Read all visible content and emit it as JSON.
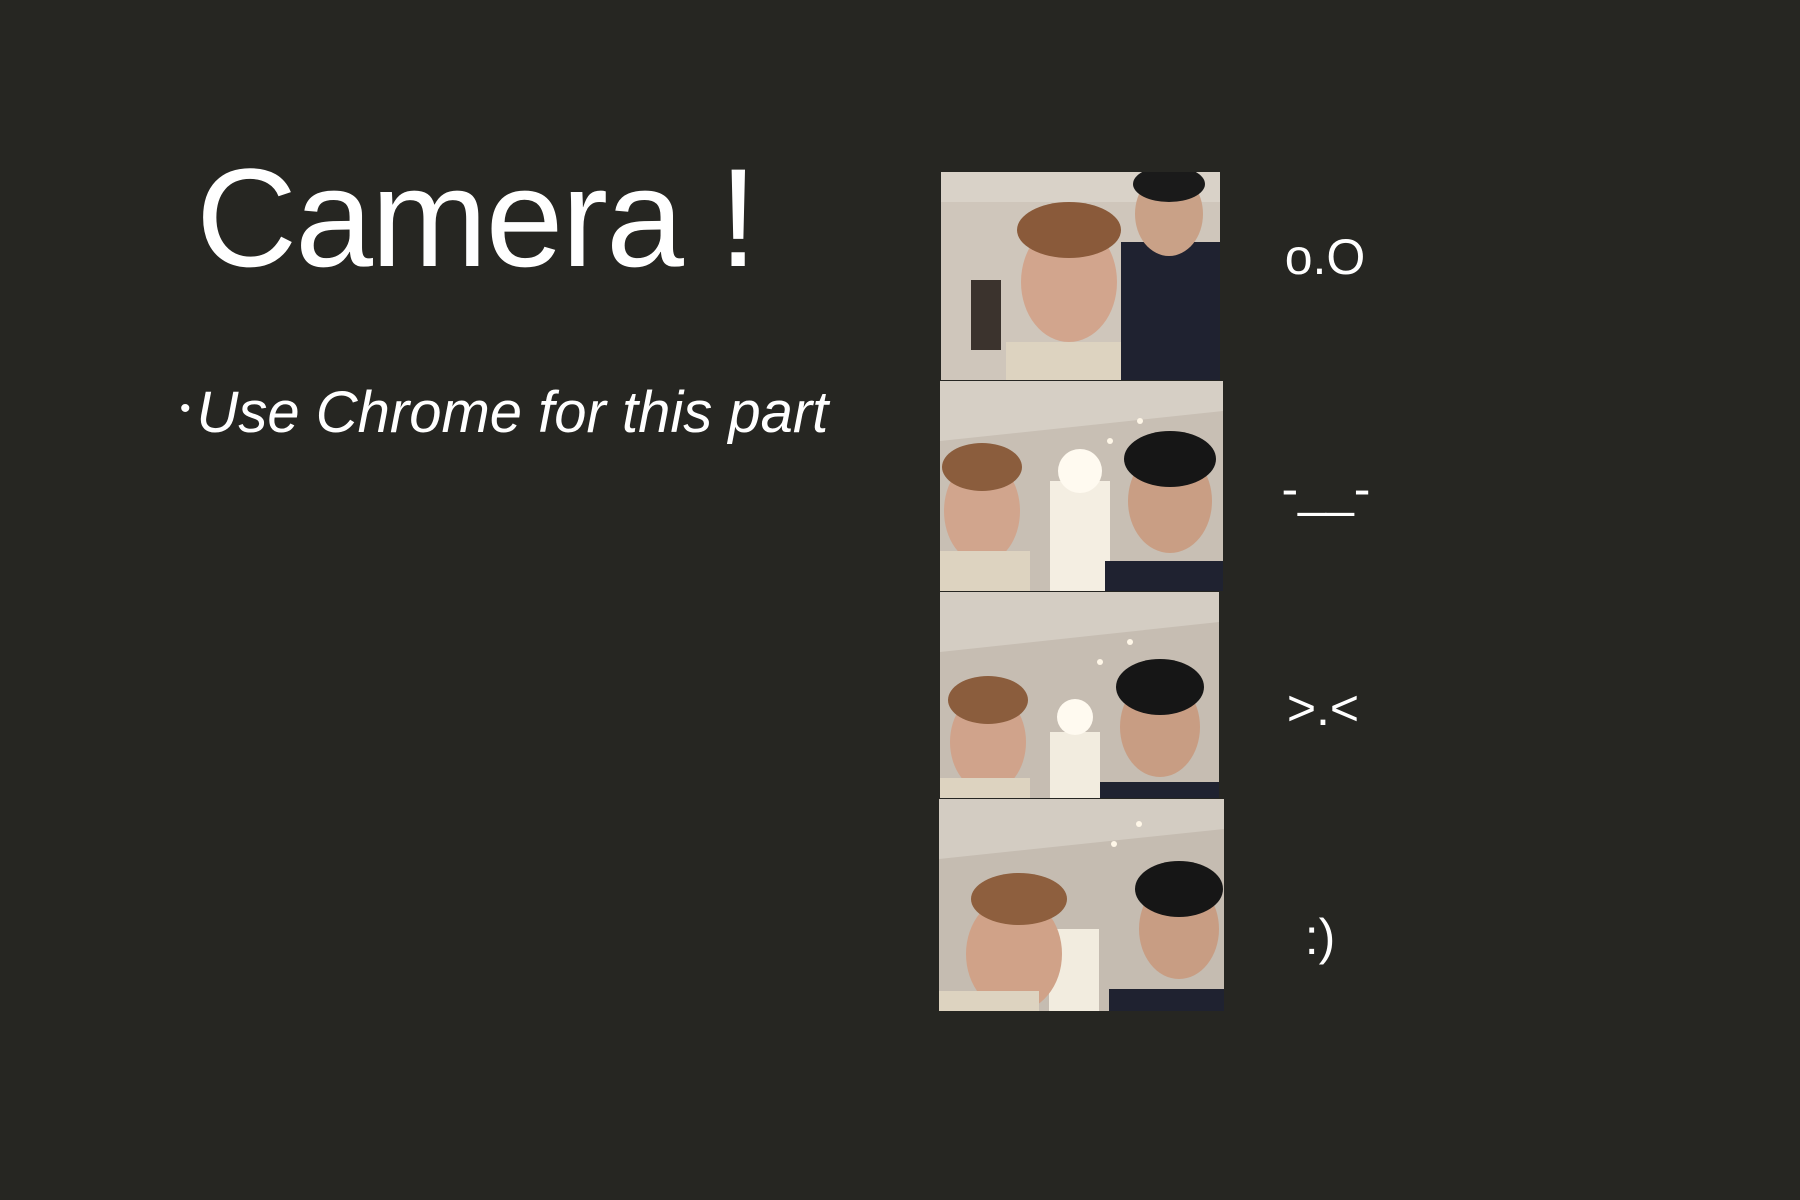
{
  "slide": {
    "title": "Camera !",
    "bullet": "Use Chrome for this part",
    "bullet_marker": "•"
  },
  "photos": [
    {
      "emoticon": "o.O"
    },
    {
      "emoticon": "-__-"
    },
    {
      "emoticon": ">.<"
    },
    {
      "emoticon": ":)"
    }
  ],
  "colors": {
    "background": "#262622",
    "text": "#ffffff"
  }
}
